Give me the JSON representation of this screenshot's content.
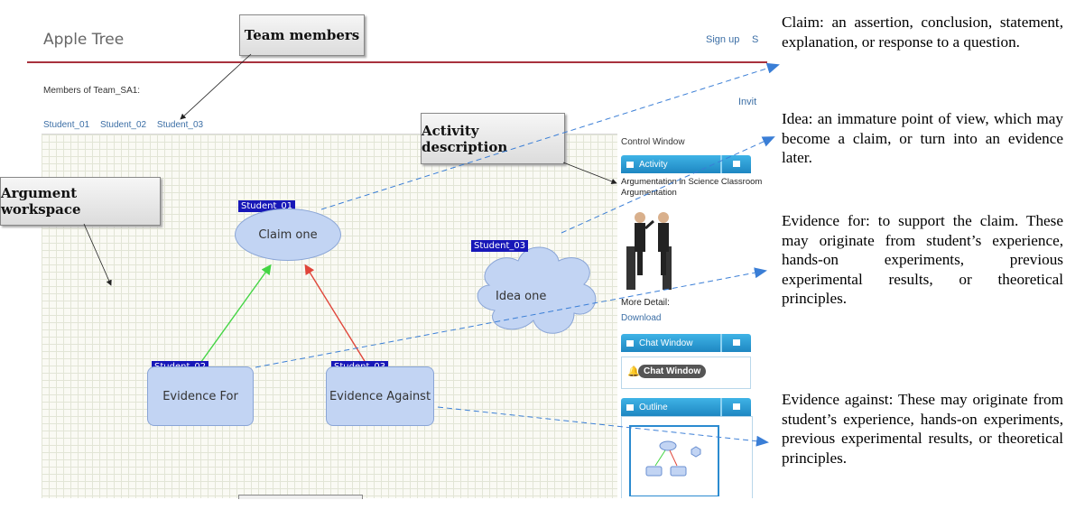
{
  "app": {
    "title": "Apple Tree",
    "sign_up": "Sign up",
    "s_link": "S",
    "members_label": "Members of Team_SA1:",
    "invite": "Invit",
    "students": [
      "Student_01",
      "Student_02",
      "Student_03"
    ]
  },
  "workspace": {
    "nodes": {
      "claim": {
        "label": "Claim one",
        "tag": "Student_01"
      },
      "idea": {
        "label": "Idea one",
        "tag": "Student_03"
      },
      "evidence_for": {
        "label": "Evidence For",
        "tag": "Student_02"
      },
      "evidence_against": {
        "label": "Evidence Against",
        "tag": "Student_03"
      }
    }
  },
  "control_window": {
    "title": "Control Window",
    "activity_tab": "Activity",
    "activity_name": "Argumentation in Science Classroom",
    "activity_type": "Argumentation",
    "more_detail": "More Detail:",
    "download": "Download",
    "chat_tab": "Chat Window",
    "chat_button": "Chat Window",
    "outline_tab": "Outline"
  },
  "callouts": {
    "team_members": "Team members",
    "activity_description": "Activity description",
    "argument_workspace": "Argument workspace"
  },
  "definitions": {
    "claim": "Claim: an assertion, conclusion, statement, explanation, or response to a question.",
    "idea": "Idea: an immature point of view, which may become a claim, or turn into an evidence later.",
    "evidence_for": "Evidence for: to support the claim. These may originate from student’s experience, hands-on experiments, previous experimental results, or theoretical principles.",
    "evidence_against": "Evidence against: These may originate from student’s experience, hands-on experiments, previous experimental results, or theoretical principles."
  },
  "colors": {
    "header_rule": "#a8323e",
    "link": "#3b6ea5",
    "node_fill": "#c2d4f3",
    "tag_bg": "#1717b8",
    "support_arrow": "#44d544",
    "oppose_arrow": "#e0453a",
    "annotation_dash": "#3a7ed6"
  }
}
